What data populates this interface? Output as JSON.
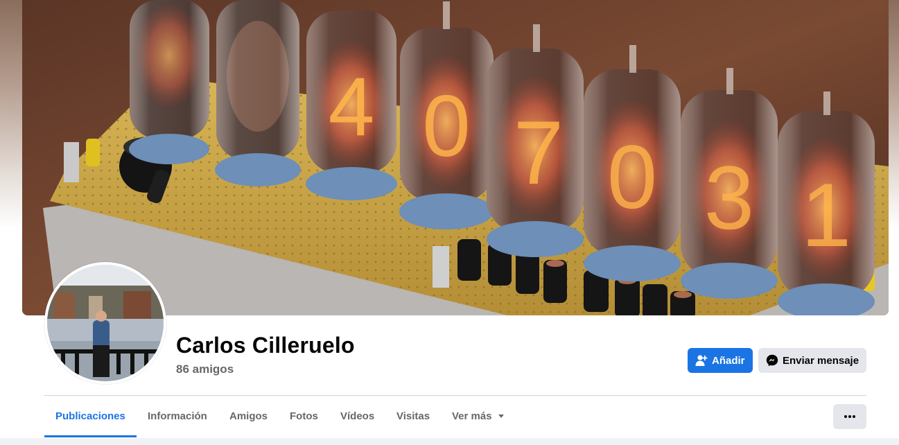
{
  "profile": {
    "name": "Carlos Cilleruelo",
    "friends": "86 amigos"
  },
  "actions": {
    "add_label": "Añadir",
    "message_label": "Enviar mensaje"
  },
  "tabs": [
    {
      "label": "Publicaciones",
      "active": true
    },
    {
      "label": "Información"
    },
    {
      "label": "Amigos"
    },
    {
      "label": "Fotos"
    },
    {
      "label": "Vídeos"
    },
    {
      "label": "Visitas"
    },
    {
      "label": "Ver más",
      "has_dropdown": true
    }
  ],
  "icons": {
    "add_friend": "person-plus-icon",
    "messenger": "messenger-icon",
    "more": "ellipsis-icon",
    "dropdown": "caret-down-icon"
  },
  "colors": {
    "accent": "#1b74e4",
    "secondary_button": "#e4e6eb",
    "text_primary": "#050505",
    "text_secondary": "#65676b"
  }
}
